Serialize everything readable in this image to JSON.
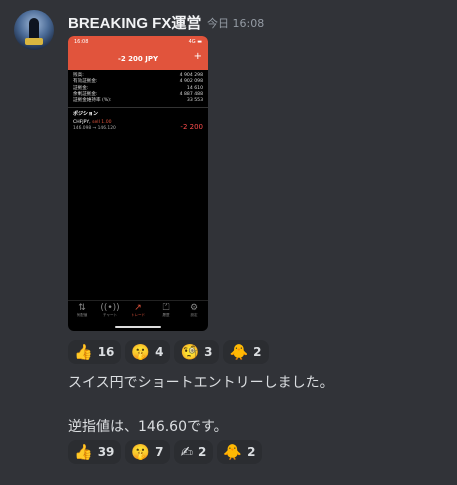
{
  "message": {
    "username": "BREAKING FX運営",
    "timestamp": "今日 16:08",
    "line1": "スイス円でショートエントリーしました。",
    "line2": "逆指値は、146.60です。"
  },
  "phone": {
    "status_time": "16:08",
    "status_right": "4G ▬",
    "header_title": "-2 200 JPY",
    "plus": "+",
    "rows": [
      {
        "label": "残高:",
        "value": "4 904 298"
      },
      {
        "label": "有効証拠金:",
        "value": "4 902 098"
      },
      {
        "label": "証拠金:",
        "value": "14 610"
      },
      {
        "label": "余剰証拠金:",
        "value": "4 887 488"
      },
      {
        "label": "証拠金維持率 (%):",
        "value": "33 553"
      }
    ],
    "positions_title": "ポジション",
    "position": {
      "pair": "CHFJPY,",
      "side": "sell 1.00",
      "price": "146.098 → 146.120",
      "pl": "-2 200"
    },
    "nav": [
      {
        "icon": "⇅",
        "label": "気配値"
      },
      {
        "icon": "((•))",
        "label": "チャート"
      },
      {
        "icon": "↗",
        "label": "トレード"
      },
      {
        "icon": "⏍",
        "label": "履歴"
      },
      {
        "icon": "⚙",
        "label": "設定"
      }
    ]
  },
  "reactions1": [
    {
      "emoji": "👍",
      "count": "16"
    },
    {
      "emoji": "🤫",
      "count": "4"
    },
    {
      "emoji": "🧐",
      "count": "3"
    },
    {
      "emoji": "🐥",
      "count": "2"
    }
  ],
  "reactions2": [
    {
      "emoji": "👍",
      "count": "39"
    },
    {
      "emoji": "🤫",
      "count": "7"
    },
    {
      "emoji": "✍",
      "count": "2"
    },
    {
      "emoji": "🐥",
      "count": "2"
    }
  ]
}
